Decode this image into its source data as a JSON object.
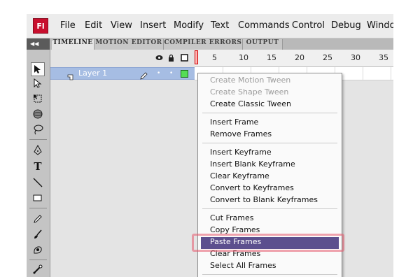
{
  "app": {
    "logo_text": "Fl"
  },
  "menubar": {
    "items": [
      "File",
      "Edit",
      "View",
      "Insert",
      "Modify",
      "Text",
      "Commands",
      "Control",
      "Debug",
      "Window"
    ]
  },
  "panel_tabs": [
    "TIMELINE",
    "MOTION EDITOR",
    "COMPILER ERRORS",
    "OUTPUT"
  ],
  "timeline": {
    "frame_numbers": [
      "5",
      "10",
      "15",
      "20",
      "25",
      "30",
      "35"
    ],
    "layer_name": "Layer 1"
  },
  "context_menu": {
    "group1": [
      "Create Motion Tween",
      "Create Shape Tween",
      "Create Classic Tween"
    ],
    "group2": [
      "Insert Frame",
      "Remove Frames"
    ],
    "group3": [
      "Insert Keyframe",
      "Insert Blank Keyframe",
      "Clear Keyframe",
      "Convert to Keyframes",
      "Convert to Blank Keyframes"
    ],
    "group4": [
      "Cut Frames",
      "Copy Frames",
      "Paste Frames",
      "Clear Frames",
      "Select All Frames"
    ],
    "highlighted_item": "Paste Frames"
  },
  "colors": {
    "highlight": "#5c4f8e",
    "layer_row": "#a6bde3",
    "logo": "#c8102e",
    "annotation_ring": "#e65a6e"
  },
  "icons": [
    "collapse-arrows-icon",
    "eye-icon",
    "lock-icon",
    "outline-icon",
    "layer-icon",
    "pencil-icon",
    "selection-tool-icon",
    "subselection-tool-icon",
    "free-transform-tool-icon",
    "3d-rotation-tool-icon",
    "lasso-tool-icon",
    "pen-tool-icon",
    "text-tool-icon",
    "line-tool-icon",
    "rectangle-tool-icon",
    "pencil-tool-icon",
    "brush-tool-icon",
    "deco-tool-icon",
    "bone-tool-icon"
  ]
}
